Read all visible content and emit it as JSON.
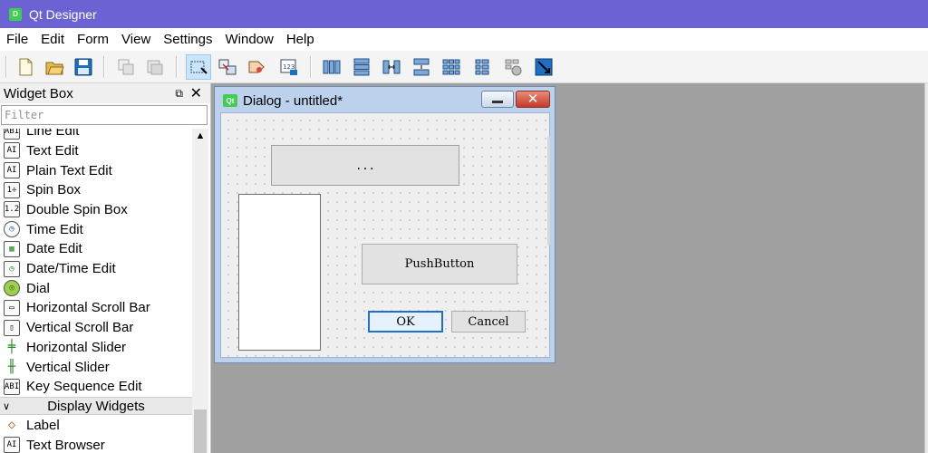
{
  "app": {
    "title": "Qt Designer",
    "icon_text": "D"
  },
  "menu": [
    "File",
    "Edit",
    "Form",
    "View",
    "Settings",
    "Window",
    "Help"
  ],
  "toolbar": {
    "icons": [
      "new-form-icon",
      "open-form-icon",
      "save-form-icon",
      "copy-icon",
      "paste-icon",
      "edit-widgets-icon",
      "edit-signals-slots-icon",
      "edit-buddies-icon",
      "edit-tab-order-icon",
      "layout-horizontal-icon",
      "layout-vertical-icon",
      "layout-horizontal-splitter-icon",
      "layout-vertical-splitter-icon",
      "layout-grid-icon",
      "layout-form-icon",
      "break-layout-icon",
      "adjust-size-icon"
    ]
  },
  "widget_box": {
    "title": "Widget Box",
    "float_icon": "⧉",
    "close_icon": "✕",
    "filter_placeholder": "Filter",
    "items": [
      {
        "label": "Line Edit",
        "icon": "ABI"
      },
      {
        "label": "Text Edit",
        "icon": "AI"
      },
      {
        "label": "Plain Text Edit",
        "icon": "AI"
      },
      {
        "label": "Spin Box",
        "icon": "1÷"
      },
      {
        "label": "Double Spin Box",
        "icon": "1.2"
      },
      {
        "label": "Time Edit",
        "icon": "◷"
      },
      {
        "label": "Date Edit",
        "icon": "▦"
      },
      {
        "label": "Date/Time Edit",
        "icon": "◷"
      },
      {
        "label": "Dial",
        "icon": "◎"
      },
      {
        "label": "Horizontal Scroll Bar",
        "icon": "▭"
      },
      {
        "label": "Vertical Scroll Bar",
        "icon": "▯"
      },
      {
        "label": "Horizontal Slider",
        "icon": "╪"
      },
      {
        "label": "Vertical Slider",
        "icon": "╫"
      },
      {
        "label": "Key Sequence Edit",
        "icon": "ABI"
      }
    ],
    "category": {
      "label": "Display Widgets",
      "arrow": "∨"
    },
    "display_items": [
      {
        "label": "Label",
        "icon": "◇"
      },
      {
        "label": "Text Browser",
        "icon": "AI"
      }
    ]
  },
  "dialog": {
    "title": "Dialog - untitled*",
    "icon_text": "Qt",
    "close_glyph": "✕",
    "frame_text": "...",
    "push_button": "PushButton",
    "ok": "OK",
    "cancel": "Cancel"
  },
  "colors": {
    "titlebar": "#6b63d4",
    "accent": "#1f6fd0",
    "canvas": "#a0a0a0"
  }
}
